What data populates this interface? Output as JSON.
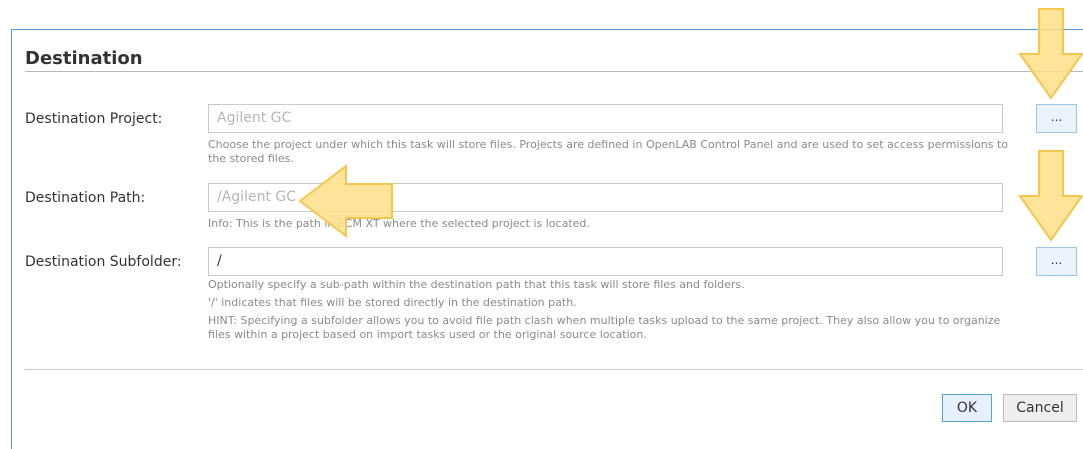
{
  "dialog": {
    "title": "Destination"
  },
  "fields": {
    "project": {
      "label": "Destination Project:",
      "value": "Agilent GC",
      "help": "Choose the project under which this task will store files. Projects are defined in OpenLAB Control Panel and are used to set access permissions to the stored files.",
      "browse_label": "..."
    },
    "path": {
      "label": "Destination Path:",
      "value": "/Agilent GC",
      "help": "Info: This is the path in ECM XT where the selected project is located."
    },
    "subfolder": {
      "label": "Destination Subfolder:",
      "value": "/",
      "help_lines": [
        "Optionally specify a sub-path within the destination path that this task will store files and folders.",
        "'/' indicates that files will be stored directly in the destination path.",
        "HINT: Specifying a subfolder allows you to avoid file path clash when multiple tasks upload to the same project. They also allow you to organize files within a project based on import tasks used or the original source location."
      ],
      "browse_label": "..."
    }
  },
  "footer": {
    "ok_label": "OK",
    "cancel_label": "Cancel"
  },
  "colors": {
    "accent": "#4a9bd8",
    "highlight_arrow": "#fde08a",
    "highlight_arrow_border": "#f4c64e"
  },
  "icons": {
    "annotation_arrow": "callout-arrow"
  }
}
